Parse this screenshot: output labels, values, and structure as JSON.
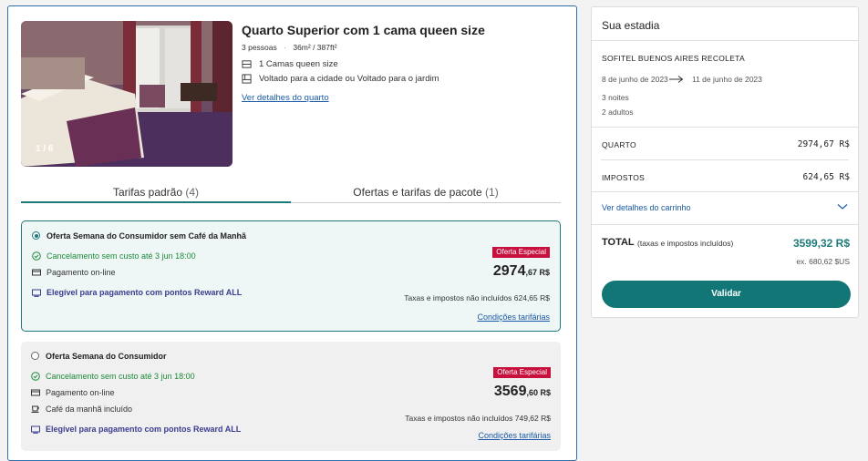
{
  "room": {
    "title": "Quarto Superior com 1 cama queen size",
    "occupancy": "3 pessoas",
    "separator": "·",
    "size": "36m² / 387ft²",
    "features": [
      {
        "icon": "bed-icon",
        "label": "1 Camas queen size"
      },
      {
        "icon": "window-view-icon",
        "label": "Voltado para a cidade ou Voltado para o jardim"
      }
    ],
    "details_link": "Ver detalhes do quarto",
    "photo_counter": "1 / 6"
  },
  "tabs": [
    {
      "label": "Tarifas padrão",
      "count": "(4)",
      "active": true
    },
    {
      "label": "Ofertas e tarifas de pacote",
      "count": "(1)",
      "active": false
    }
  ],
  "offers": [
    {
      "name": "Oferta Semana do Consumidor sem Café da Manhã",
      "selected": true,
      "cancellation": "Cancelamento sem custo até 3 jun 18:00",
      "payment": "Pagamento on-line",
      "breakfast": "",
      "reward": "Elegível para pagamento com pontos Reward ALL",
      "badge": "Oferta Especial",
      "price_main": "2974",
      "price_dec": ",67 R$",
      "taxes": "Taxas e impostos não incluídos 624,65 R$",
      "conditions_link": "Condições tarifárias"
    },
    {
      "name": "Oferta Semana do Consumidor",
      "selected": false,
      "cancellation": "Cancelamento sem custo até 3 jun 18:00",
      "payment": "Pagamento on-line",
      "breakfast": "Café da manhã incluído",
      "reward": "Elegível para pagamento com pontos Reward ALL",
      "badge": "Oferta Especial",
      "price_main": "3569",
      "price_dec": ",60 R$",
      "taxes": "Taxas e impostos não incluídos 749,62 R$",
      "conditions_link": "Condições tarifárias"
    }
  ],
  "summary": {
    "title": "Sua estadia",
    "hotel": "SOFITEL BUENOS AIRES RECOLETA",
    "date_from": "8 de junho de 2023",
    "date_to": "11 de junho de 2023",
    "nights": "3 noites",
    "adults": "2 adultos",
    "room_label": "QUARTO",
    "room_value": "2974,67 R$",
    "tax_label": "IMPOSTOS",
    "tax_value": "624,65 R$",
    "cart_link": "Ver detalhes do carrinho",
    "total_label": "TOTAL",
    "total_note": "(taxas e impostos incluídos)",
    "total_value": "3599,32 R$",
    "total_usd": "ex. 680,62 $US",
    "validate_label": "Validar"
  },
  "colors": {
    "accent_teal": "#127676",
    "link_blue": "#1a5aa6",
    "badge_red": "#c8103d",
    "success_green": "#1e8a3a",
    "reward_indigo": "#3a3d8f"
  }
}
